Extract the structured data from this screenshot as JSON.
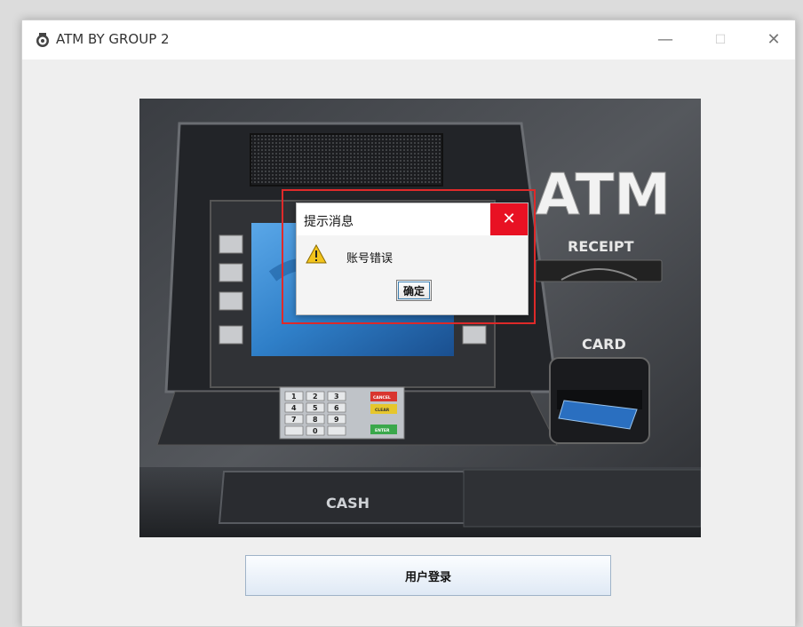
{
  "window": {
    "title": "ATM BY GROUP 2",
    "controls": {
      "minimize": "—",
      "maximize": "☐",
      "close": "✕"
    }
  },
  "atm_image": {
    "brand_text": "ATM",
    "receipt_label": "RECEIPT",
    "card_label": "CARD",
    "cash_label": "CASH",
    "keypad": {
      "keys": [
        "1",
        "2",
        "3",
        "4",
        "5",
        "6",
        "7",
        "8",
        "9",
        "",
        "0",
        ""
      ],
      "function_keys": [
        "CANCEL",
        "CLEAR",
        "ENTER"
      ]
    }
  },
  "login_button": {
    "label": "用户登录"
  },
  "dialog": {
    "title": "提示消息",
    "close": "✕",
    "message": "账号错误",
    "ok_label": "确定"
  },
  "colors": {
    "highlight": "#e02a2a",
    "dialog_close_bg": "#e81123",
    "atm_screen": "#2f7fc8"
  }
}
